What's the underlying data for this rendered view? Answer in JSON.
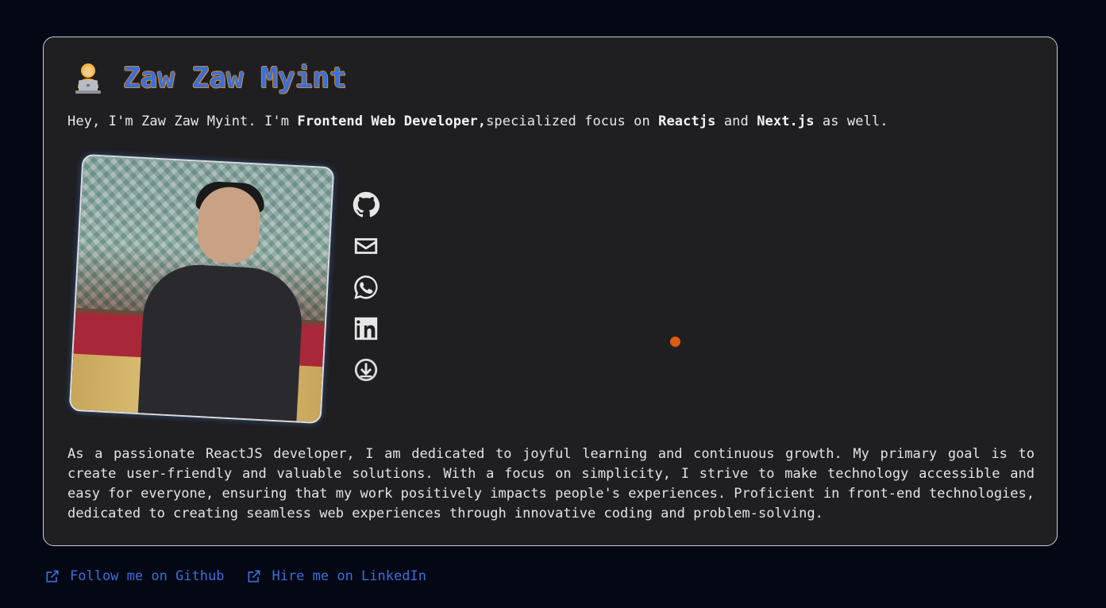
{
  "header": {
    "name": "Zaw Zaw Myint",
    "avatar_icon": "technologist-emoji-icon"
  },
  "intro": {
    "part1": "Hey, I'm Zaw Zaw Myint. I'm ",
    "role": "Frontend Web Developer,",
    "part2": "specialized focus on ",
    "tech1": "Reactjs",
    "part3": " and ",
    "tech2": "Next.js",
    "part4": " as well."
  },
  "social": {
    "icons": [
      "github-icon",
      "mail-icon",
      "whatsapp-icon",
      "linkedin-icon",
      "download-icon"
    ]
  },
  "about": {
    "text": "As a passionate ReactJS developer, I am dedicated to joyful learning and continuous growth. My primary goal is to create user-friendly and valuable solutions. With a focus on simplicity, I strive to make technology accessible and easy for everyone, ensuring that my work positively impacts people's experiences. Proficient in front-end technologies, dedicated to creating seamless web experiences through innovative coding and problem-solving."
  },
  "footer_links": {
    "github": "Follow me on Github",
    "linkedin": "Hire me on LinkedIn"
  },
  "colors": {
    "accent": "#3b6fd8",
    "title_outline": "#d18a2a",
    "dot": "#e05a12",
    "background": "#040814",
    "card": "#1f1f22"
  }
}
